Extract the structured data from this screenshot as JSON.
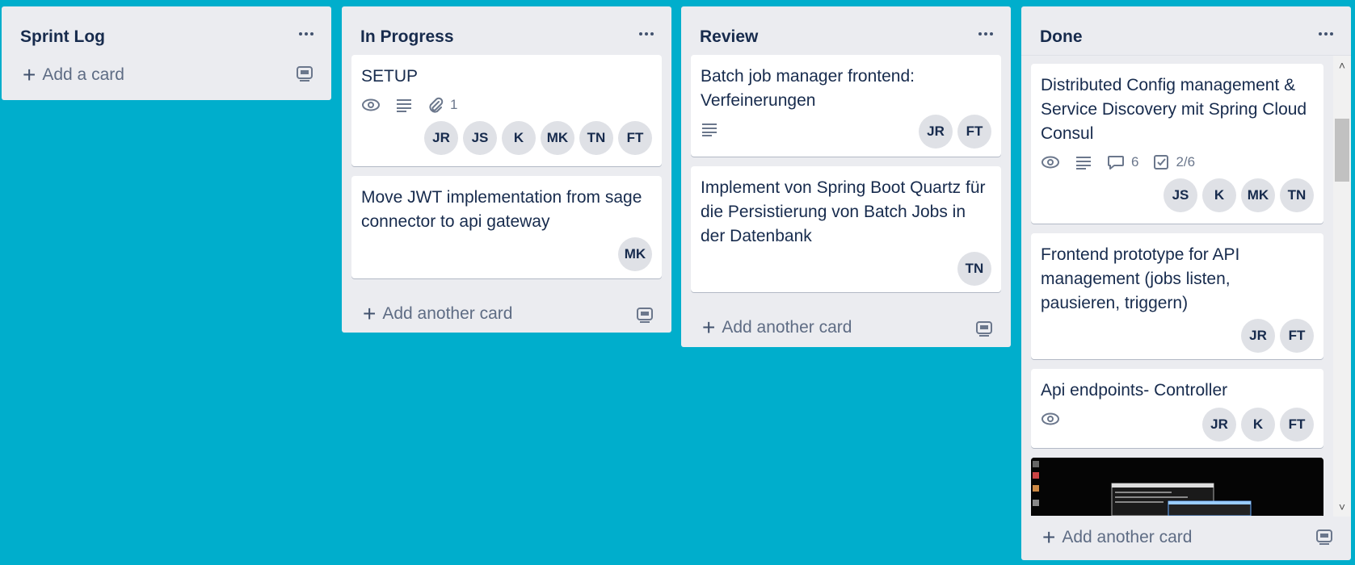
{
  "lists": [
    {
      "title": "Sprint Log",
      "add_label": "Add a card"
    },
    {
      "title": "In Progress",
      "cards": [
        {
          "title": "SETUP",
          "attachment_count": "1",
          "members": [
            "JR",
            "JS",
            "K",
            "MK",
            "TN",
            "FT"
          ]
        },
        {
          "title": "Move JWT implementation from sage connector to api gateway",
          "members": [
            "MK"
          ]
        }
      ],
      "add_label": "Add another card"
    },
    {
      "title": "Review",
      "cards": [
        {
          "title": "Batch job manager frontend: Verfeinerungen",
          "members": [
            "JR",
            "FT"
          ]
        },
        {
          "title": "Implement von Spring Boot Quartz für die Persistierung von Batch Jobs in der Datenbank",
          "members": [
            "TN"
          ]
        }
      ],
      "add_label": "Add another card"
    },
    {
      "title": "Done",
      "cards": [
        {
          "title": "Distributed Config management & Service Discovery mit Spring Cloud Consul",
          "comments": "6",
          "checklist": "2/6",
          "members": [
            "JS",
            "K",
            "MK",
            "TN"
          ]
        },
        {
          "title": "Frontend prototype for API management (jobs listen, pausieren, triggern)",
          "members": [
            "JR",
            "FT"
          ]
        },
        {
          "title": "Api endpoints- Controller",
          "members": [
            "JR",
            "K",
            "FT"
          ]
        }
      ],
      "add_label": "Add another card"
    }
  ],
  "colors": {
    "board_bg": "#00aecc",
    "list_bg": "#ebecf0",
    "card_bg": "#ffffff",
    "avatar_bg": "#dfe1e6",
    "text": "#172b4d"
  }
}
